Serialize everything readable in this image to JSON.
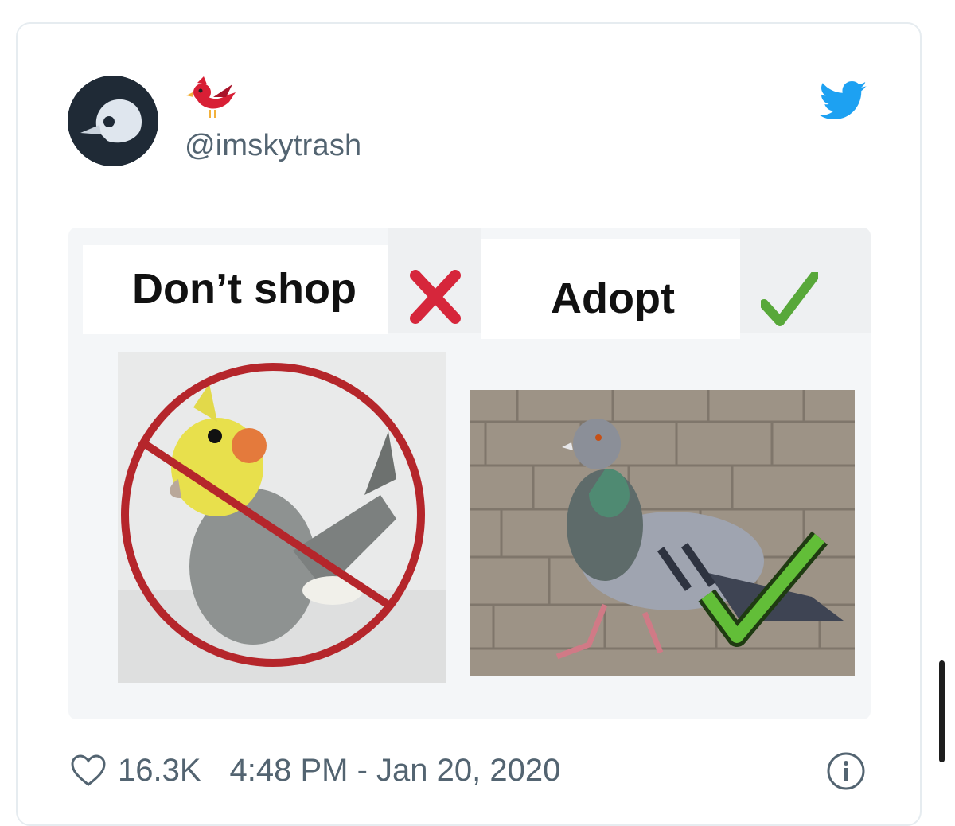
{
  "tweet": {
    "handle": "@imskytrash",
    "display_name_emoji": "red-bird-emoji",
    "meme": {
      "left_caption": "Don’t shop",
      "right_caption": "Adopt",
      "left_mark": "cross-mark-icon",
      "right_mark": "check-mark-icon"
    },
    "likes": "16.3K",
    "timestamp": "4:48 PM - Jan 20, 2020"
  },
  "colors": {
    "twitter_blue": "#1da1f2",
    "cross_red": "#d6263b",
    "check_green": "#58a83a",
    "meta_text": "#536471"
  }
}
